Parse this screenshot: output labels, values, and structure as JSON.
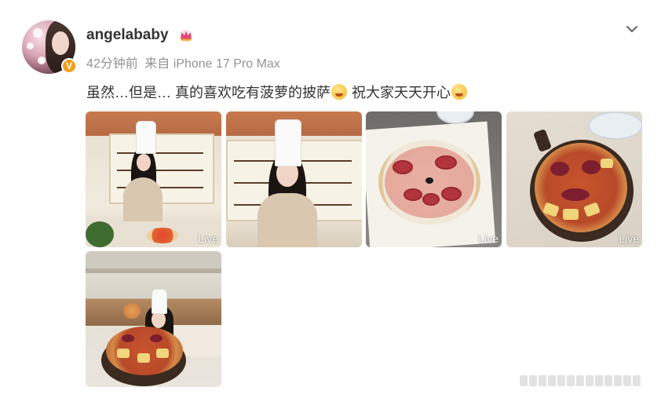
{
  "post": {
    "username": "angelababy",
    "time": "42分钟前",
    "source": "来自 iPhone 17 Pro Max",
    "text_part1": "虽然…但是… 真的喜欢吃有菠萝的披萨",
    "text_part2": " 祝大家天天开心",
    "badge": "V"
  },
  "photos": [
    {
      "live_label": "Live"
    },
    {
      "live_label": ""
    },
    {
      "live_label": "Live"
    },
    {
      "live_label": "Live"
    },
    {
      "live_label": ""
    }
  ],
  "colors": {
    "username": "#333333",
    "meta": "#939393",
    "verified_badge": "#f59e1b",
    "crown": "#e64a7d"
  },
  "icons": {
    "member": "crown-icon",
    "more": "chevron-down-icon",
    "verified": "verified-badge-icon"
  }
}
